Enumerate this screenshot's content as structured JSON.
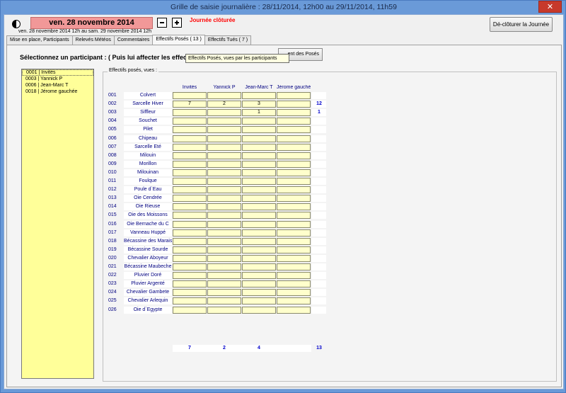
{
  "window": {
    "title": "Grille de saisie journalière : 28/11/2014, 12h00 au 29/11/2014, 11h59",
    "close": "✕"
  },
  "header": {
    "date": "ven. 28 novembre 2014",
    "status": "Journée clôturée",
    "range": "ven. 28 novembre 2014 12h au sam. 29 novembre 2014 12h",
    "decloture_label": "Dé-clôturer la Journée"
  },
  "tabs": [
    {
      "label": "Mise en place, Participants"
    },
    {
      "label": "Relevés Météos"
    },
    {
      "label": "Commentaires"
    },
    {
      "label": "Effectifs Posés ( 13 )"
    },
    {
      "label": "Effectifs Tués ( 7 )"
    }
  ],
  "panel": {
    "instruction": "Sélectionnez un participant : ( Puis lui affecter les effec",
    "tooltip": "Effectifs Posés, vues par les participants",
    "reset_label": "ent des Posés",
    "group_label": "Effectifs posés, vues :"
  },
  "participants": [
    {
      "label": "0001 | Invités"
    },
    {
      "label": "0003 | Yannick P"
    },
    {
      "label": "0006 | Jean-Marc T"
    },
    {
      "label": "0018 | Jérome gauchée"
    }
  ],
  "grid": {
    "columns": [
      "Invités",
      "Yannick P",
      "Jean-Marc T",
      "Jérome gauchée"
    ],
    "rows": [
      {
        "code": "001",
        "name": "Colvert",
        "values": [
          "",
          "",
          "",
          ""
        ],
        "total": ""
      },
      {
        "code": "002",
        "name": "Sarcelle Hiver",
        "values": [
          "7",
          "2",
          "3",
          ""
        ],
        "total": "12"
      },
      {
        "code": "003",
        "name": "Siffleur",
        "values": [
          "",
          "",
          "1",
          ""
        ],
        "total": "1"
      },
      {
        "code": "004",
        "name": "Souchet",
        "values": [
          "",
          "",
          "",
          ""
        ],
        "total": ""
      },
      {
        "code": "005",
        "name": "Pilet",
        "values": [
          "",
          "",
          "",
          ""
        ],
        "total": ""
      },
      {
        "code": "006",
        "name": "Chipeau",
        "values": [
          "",
          "",
          "",
          ""
        ],
        "total": ""
      },
      {
        "code": "007",
        "name": "Sarcelle Eté",
        "values": [
          "",
          "",
          "",
          ""
        ],
        "total": ""
      },
      {
        "code": "008",
        "name": "Milouin",
        "values": [
          "",
          "",
          "",
          ""
        ],
        "total": ""
      },
      {
        "code": "009",
        "name": "Morillon",
        "values": [
          "",
          "",
          "",
          ""
        ],
        "total": ""
      },
      {
        "code": "010",
        "name": "Milouinan",
        "values": [
          "",
          "",
          "",
          ""
        ],
        "total": ""
      },
      {
        "code": "011",
        "name": "Foulque",
        "values": [
          "",
          "",
          "",
          ""
        ],
        "total": ""
      },
      {
        "code": "012",
        "name": "Poule d`Eau",
        "values": [
          "",
          "",
          "",
          ""
        ],
        "total": ""
      },
      {
        "code": "013",
        "name": "Oie Cendrée",
        "values": [
          "",
          "",
          "",
          ""
        ],
        "total": ""
      },
      {
        "code": "014",
        "name": "Oie Rieuse",
        "values": [
          "",
          "",
          "",
          ""
        ],
        "total": ""
      },
      {
        "code": "015",
        "name": "Oie des Moissons",
        "values": [
          "",
          "",
          "",
          ""
        ],
        "total": ""
      },
      {
        "code": "016",
        "name": "Oie Bernache du C",
        "values": [
          "",
          "",
          "",
          ""
        ],
        "total": ""
      },
      {
        "code": "017",
        "name": "Vanneau Huppé",
        "values": [
          "",
          "",
          "",
          ""
        ],
        "total": ""
      },
      {
        "code": "018",
        "name": "Bécassine des Marais",
        "values": [
          "",
          "",
          "",
          ""
        ],
        "total": ""
      },
      {
        "code": "019",
        "name": "Bécassine Sourde",
        "values": [
          "",
          "",
          "",
          ""
        ],
        "total": ""
      },
      {
        "code": "020",
        "name": "Chevalier Aboyeur",
        "values": [
          "",
          "",
          "",
          ""
        ],
        "total": ""
      },
      {
        "code": "021",
        "name": "Bécassine Maubeche",
        "values": [
          "",
          "",
          "",
          ""
        ],
        "total": ""
      },
      {
        "code": "022",
        "name": "Pluvier Doré",
        "values": [
          "",
          "",
          "",
          ""
        ],
        "total": ""
      },
      {
        "code": "023",
        "name": "Pluvier Argenté",
        "values": [
          "",
          "",
          "",
          ""
        ],
        "total": ""
      },
      {
        "code": "024",
        "name": "Chevalier Gambete",
        "values": [
          "",
          "",
          "",
          ""
        ],
        "total": ""
      },
      {
        "code": "025",
        "name": "Chevalier Arlequin",
        "values": [
          "",
          "",
          "",
          ""
        ],
        "total": ""
      },
      {
        "code": "026",
        "name": "Oie d`Egypte",
        "values": [
          "",
          "",
          "",
          ""
        ],
        "total": ""
      }
    ],
    "column_totals": [
      "7",
      "2",
      "4",
      ""
    ],
    "grand_total": "13"
  },
  "colors": {
    "date_bg": "#f19898",
    "status": "#ff0000",
    "list_bg": "#ffff99",
    "cell_bg": "#ffffcc",
    "totals": "#0000cc"
  },
  "icons": {
    "moon": "moon-icon",
    "prev": "minus-icon",
    "next": "plus-icon",
    "close": "close-icon"
  }
}
